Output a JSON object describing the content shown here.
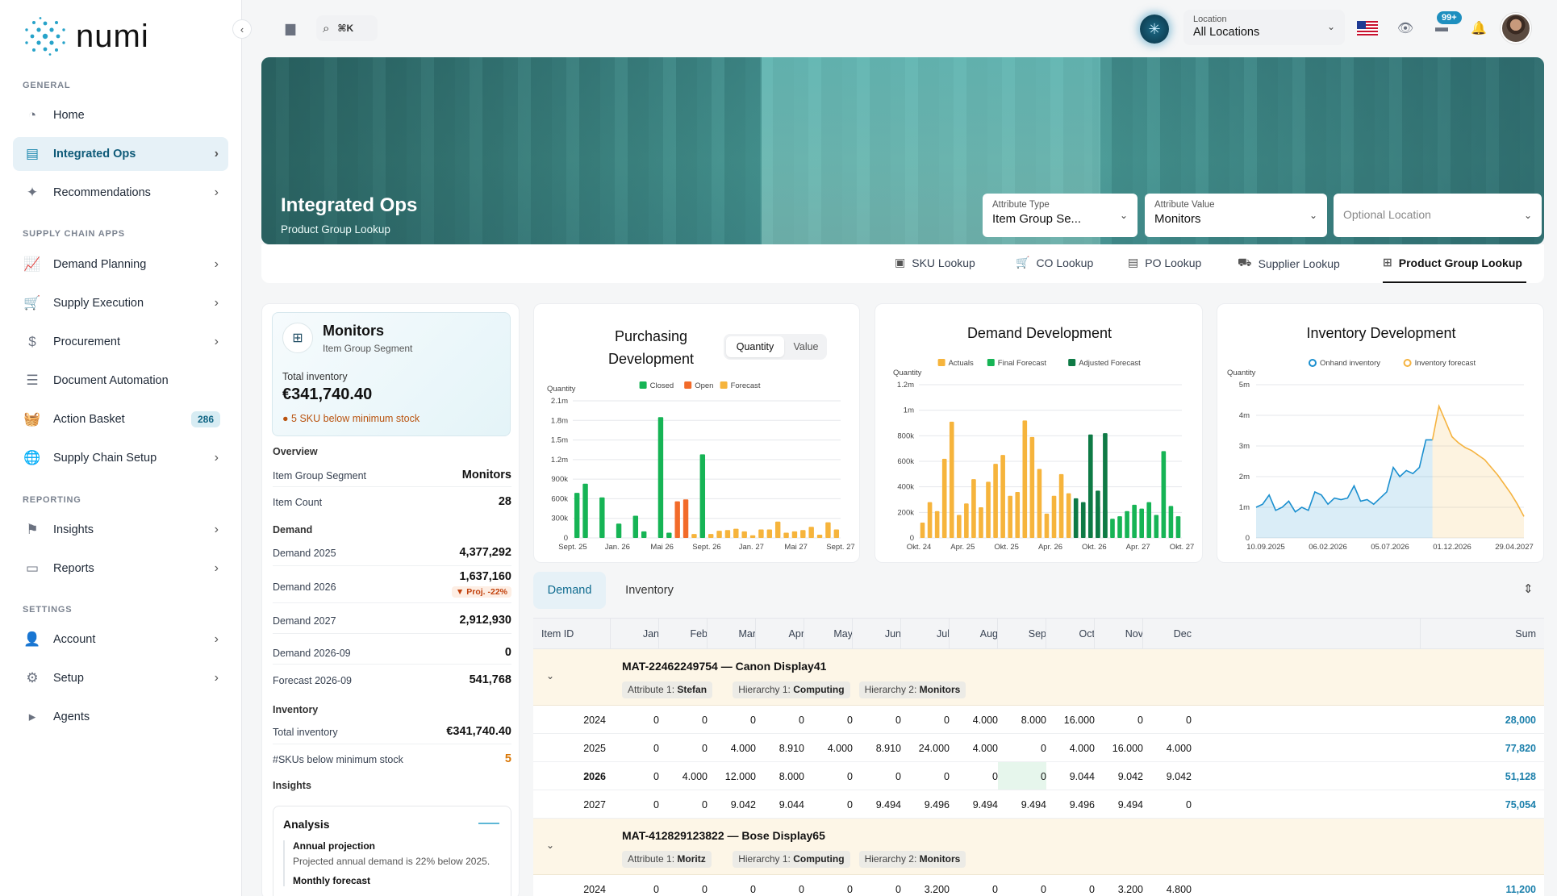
{
  "app": {
    "name": "numi"
  },
  "sidebar": {
    "sections": {
      "general": "GENERAL",
      "supply": "SUPPLY CHAIN APPS",
      "reporting": "REPORTING",
      "settings": "SETTINGS"
    },
    "items": {
      "home": "Home",
      "integrated_ops": "Integrated Ops",
      "recommendations": "Recommendations",
      "demand_planning": "Demand Planning",
      "supply_execution": "Supply Execution",
      "procurement": "Procurement",
      "document_automation": "Document Automation",
      "action_basket": "Action Basket",
      "action_basket_badge": "286",
      "supply_chain_setup": "Supply Chain Setup",
      "insights": "Insights",
      "reports": "Reports",
      "account": "Account",
      "setup": "Setup",
      "agents": "Agents"
    }
  },
  "topbar": {
    "search_shortcut": "⌘K",
    "location_label": "Location",
    "location_value": "All Locations",
    "notification_count": "99+"
  },
  "hero": {
    "title": "Integrated Ops",
    "subtitle": "Product Group Lookup",
    "attr_type_label": "Attribute Type",
    "attr_type_value": "Item Group Se...",
    "attr_value_label": "Attribute Value",
    "attr_value_value": "Monitors",
    "location_placeholder": "Optional Location"
  },
  "tabs": {
    "sku": "SKU Lookup",
    "co": "CO Lookup",
    "po": "PO Lookup",
    "supplier": "Supplier Lookup",
    "product_group": "Product Group Lookup"
  },
  "summary": {
    "title": "Monitors",
    "subtitle": "Item Group Segment",
    "total_inventory_label": "Total inventory",
    "total_inventory_value": "€341,740.40",
    "warning": "5 SKU below minimum stock",
    "overview_h": "Overview",
    "item_group_segment_label": "Item Group Segment",
    "item_group_segment_value": "Monitors",
    "item_count_label": "Item Count",
    "item_count_value": "28",
    "demand_h": "Demand",
    "d2025_label": "Demand 2025",
    "d2025_value": "4,377,292",
    "d2026_label": "Demand 2026",
    "d2026_value": "1,637,160",
    "d2026_proj": "▼ Proj. -22%",
    "d2027_label": "Demand 2027",
    "d2027_value": "2,912,930",
    "d2026_09_label": "Demand 2026-09",
    "d2026_09_value": "0",
    "f2026_09_label": "Forecast 2026-09",
    "f2026_09_value": "541,768",
    "inventory_h": "Inventory",
    "inv_total_label": "Total inventory",
    "inv_total_value": "€341,740.40",
    "skus_below_label": "#SKUs below minimum stock",
    "skus_below_value": "5",
    "insights_h": "Insights",
    "analysis_title": "Analysis",
    "annual_h": "Annual projection",
    "annual_p": "Projected annual demand is 22% below 2025.",
    "monthly_h": "Monthly forecast"
  },
  "charts": {
    "purchasing_title_1": "Purchasing",
    "purchasing_title_2": "Development",
    "seg_quantity": "Quantity",
    "seg_value": "Value",
    "demand_title": "Demand Development",
    "inventory_title": "Inventory Development"
  },
  "chart_data": [
    {
      "type": "bar",
      "title": "Purchasing Development",
      "ylabel": "Quantity",
      "ylim": [
        0,
        2100000
      ],
      "yticks": [
        "0",
        "300k",
        "600k",
        "900k",
        "1.2m",
        "1.5m",
        "1.8m",
        "2.1m"
      ],
      "xticks": [
        "Sept. 25",
        "Jan. 26",
        "Mai 26",
        "Sept. 26",
        "Jan. 27",
        "Mai 27",
        "Sept. 27"
      ],
      "legend_position": "top",
      "colors": {
        "Closed": "#16b455",
        "Open": "#f26b2a",
        "Forecast": "#f6b43c"
      },
      "series": [
        {
          "name": "Closed",
          "values": [
            690000,
            830000,
            0,
            620000,
            0,
            220000,
            0,
            340000,
            100000,
            0,
            1850000,
            80000,
            0,
            0,
            0,
            1280000,
            0,
            0,
            0,
            0,
            0,
            0,
            0,
            0,
            0,
            0,
            0,
            0,
            0,
            0,
            0,
            0
          ]
        },
        {
          "name": "Open",
          "values": [
            0,
            0,
            0,
            0,
            0,
            0,
            0,
            0,
            0,
            0,
            0,
            0,
            560000,
            590000,
            0,
            0,
            0,
            0,
            0,
            0,
            0,
            0,
            0,
            0,
            0,
            0,
            0,
            0,
            0,
            0,
            0,
            0
          ]
        },
        {
          "name": "Forecast",
          "values": [
            0,
            0,
            0,
            0,
            0,
            0,
            0,
            0,
            0,
            0,
            0,
            0,
            0,
            0,
            60000,
            0,
            60000,
            110000,
            120000,
            140000,
            100000,
            40000,
            130000,
            130000,
            250000,
            80000,
            100000,
            120000,
            170000,
            50000,
            240000,
            130000
          ]
        }
      ]
    },
    {
      "type": "bar",
      "title": "Demand Development",
      "ylabel": "Quantity",
      "ylim": [
        0,
        1200000
      ],
      "yticks": [
        "0",
        "200k",
        "400k",
        "600k",
        "800k",
        "1m",
        "1.2m"
      ],
      "xticks": [
        "Okt. 24",
        "Apr. 25",
        "Okt. 25",
        "Apr. 26",
        "Okt. 26",
        "Apr. 27",
        "Okt. 27"
      ],
      "legend_position": "top",
      "colors": {
        "Actuals": "#f6b43c",
        "Final Forecast": "#16b455",
        "Adjusted Forecast": "#0e7a45"
      },
      "series": [
        {
          "name": "Actuals",
          "values": [
            120000,
            280000,
            210000,
            620000,
            910000,
            180000,
            270000,
            460000,
            240000,
            440000,
            580000,
            650000,
            330000,
            360000,
            920000,
            790000,
            540000,
            190000,
            330000,
            500000,
            350000,
            170000,
            240000,
            50000,
            0,
            0,
            0,
            0,
            0,
            0,
            0,
            0,
            0,
            0,
            0,
            0
          ]
        },
        {
          "name": "Final Forecast",
          "values": [
            0,
            0,
            0,
            0,
            0,
            0,
            0,
            0,
            0,
            0,
            0,
            0,
            0,
            0,
            0,
            0,
            0,
            0,
            0,
            0,
            0,
            0,
            0,
            0,
            250000,
            220000,
            150000,
            170000,
            210000,
            260000,
            230000,
            280000,
            180000,
            680000,
            250000,
            170000
          ]
        },
        {
          "name": "Adjusted Forecast",
          "values": [
            0,
            0,
            0,
            0,
            0,
            0,
            0,
            0,
            0,
            0,
            0,
            0,
            0,
            0,
            0,
            0,
            0,
            0,
            0,
            0,
            0,
            310000,
            280000,
            810000,
            370000,
            820000,
            0,
            0,
            0,
            0,
            0,
            0,
            0,
            0,
            0,
            0
          ]
        }
      ]
    },
    {
      "type": "area",
      "title": "Inventory Development",
      "ylabel": "Quantity",
      "ylim": [
        0,
        5000000
      ],
      "yticks": [
        "0",
        "1m",
        "2m",
        "3m",
        "4m",
        "5m"
      ],
      "xticks": [
        "10.09.2025",
        "06.02.2026",
        "05.07.2026",
        "01.12.2026",
        "29.04.2027"
      ],
      "legend_position": "top",
      "colors": {
        "Onhand inventory": "#1a8fcf",
        "Inventory forecast": "#f5b340"
      },
      "series": [
        {
          "name": "Onhand inventory",
          "values": [
            1000000,
            1100000,
            1400000,
            900000,
            1000000,
            1200000,
            850000,
            1000000,
            900000,
            1500000,
            1400000,
            1100000,
            1300000,
            1250000,
            1300000,
            1700000,
            1200000,
            1250000,
            1100000,
            1300000,
            1500000,
            2300000,
            2000000,
            2200000,
            2100000,
            2300000,
            3200000,
            3200000
          ]
        },
        {
          "name": "Inventory forecast",
          "values": [
            4300000,
            3800000,
            3300000,
            3100000,
            2950000,
            2850000,
            2700000,
            2550000,
            2300000,
            2050000,
            1750000,
            1450000,
            1100000,
            700000
          ]
        }
      ]
    }
  ],
  "table": {
    "tab_demand": "Demand",
    "tab_inventory": "Inventory",
    "headers": [
      "Item ID",
      "Jan",
      "Feb",
      "Mar",
      "Apr",
      "May",
      "Jun",
      "Jul",
      "Aug",
      "Sep",
      "Oct",
      "Nov",
      "Dec",
      "Sum"
    ],
    "groups": [
      {
        "title": "MAT-22462249754 — Canon Display41",
        "chips": [
          [
            "Attribute 1:",
            "Stefan"
          ],
          [
            "Hierarchy 1:",
            "Computing"
          ],
          [
            "Hierarchy 2:",
            "Monitors"
          ]
        ],
        "rows": [
          [
            "2024",
            "0",
            "0",
            "0",
            "0",
            "0",
            "0",
            "0",
            "4.000",
            "8.000",
            "16.000",
            "0",
            "0",
            "28,000"
          ],
          [
            "2025",
            "0",
            "0",
            "4.000",
            "8.910",
            "4.000",
            "8.910",
            "24.000",
            "4.000",
            "0",
            "4.000",
            "16.000",
            "4.000",
            "77,820"
          ],
          [
            "2026",
            "0",
            "4.000",
            "12.000",
            "8.000",
            "0",
            "0",
            "0",
            "0",
            "0",
            "9.044",
            "9.042",
            "9.042",
            "51,128"
          ],
          [
            "2027",
            "0",
            "0",
            "9.042",
            "9.044",
            "0",
            "9.494",
            "9.496",
            "9.494",
            "9.494",
            "9.496",
            "9.494",
            "0",
            "75,054"
          ]
        ]
      },
      {
        "title": "MAT-412829123822 — Bose Display65",
        "chips": [
          [
            "Attribute 1:",
            "Moritz"
          ],
          [
            "Hierarchy 1:",
            "Computing"
          ],
          [
            "Hierarchy 2:",
            "Monitors"
          ]
        ],
        "rows": [
          [
            "2024",
            "0",
            "0",
            "0",
            "0",
            "0",
            "0",
            "3.200",
            "0",
            "0",
            "0",
            "3.200",
            "4.800",
            "11,200"
          ]
        ]
      }
    ]
  }
}
